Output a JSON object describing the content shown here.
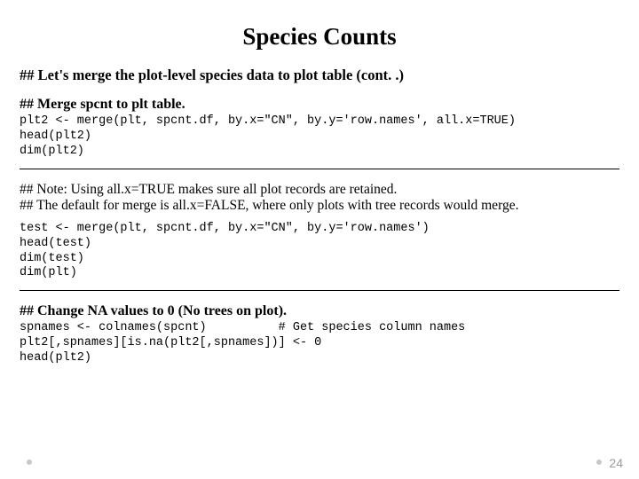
{
  "title": "Species Counts",
  "subtitle": "## Let's merge the plot-level species data to plot table (cont. .)",
  "section1": {
    "head": "## Merge spcnt to plt table.",
    "code": "plt2 <- merge(plt, spcnt.df, by.x=\"CN\", by.y='row.names', all.x=TRUE)\nhead(plt2)\ndim(plt2)"
  },
  "note": {
    "line1": "## Note: Using all.x=TRUE makes sure all plot records are retained.",
    "line2": "## The default for merge is all.x=FALSE, where only plots with tree records would merge."
  },
  "code2": "test <- merge(plt, spcnt.df, by.x=\"CN\", by.y='row.names')\nhead(test)\ndim(test)\ndim(plt)",
  "section3": {
    "head": "## Change NA values to 0 (No trees on plot).",
    "code": "spnames <- colnames(spcnt)          # Get species column names\nplt2[,spnames][is.na(plt2[,spnames])] <- 0\nhead(plt2)"
  },
  "page_number": "24"
}
